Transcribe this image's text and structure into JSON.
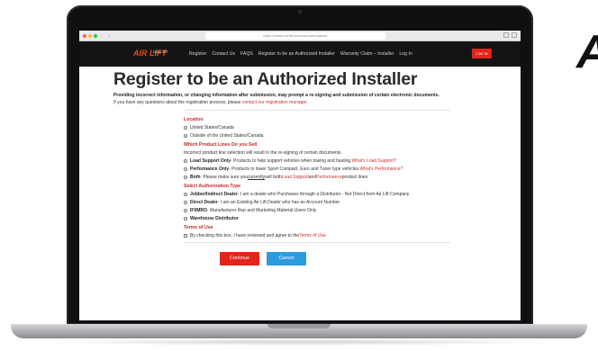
{
  "edge_text": "A",
  "browser": {
    "url": "https://dealer.airliftcompany.com/register"
  },
  "site": {
    "logo": "AIR LIFT",
    "logo_sub": "DEALER",
    "nav": [
      "Register",
      "Contact Us",
      "FAQS",
      "Register to be an Authorized Installer",
      "Warranty Claim – Installer",
      "Log In"
    ],
    "login_button": "LOG IN"
  },
  "page": {
    "title": "Register to be an Authorized Installer",
    "warning": "Providing incorrect information, or changing information after submission, may prompt a re-signing and submission of certain electronic documents.",
    "intro_text": "If you have any questions about the registration process, please ",
    "intro_link": "contact our registration manager."
  },
  "location": {
    "heading": "Location",
    "options": [
      "United States/Canada",
      "Outside of the United States/Canada"
    ]
  },
  "product_lines": {
    "heading": "Which Product Lines Do you Sell",
    "note": "Incorrect product line selection will result in the re-signing of certain documents.",
    "load_support": {
      "name": "Load Support Only",
      "desc": " - Products to help support vehicles when towing and hauling. ",
      "link": "What's Load Support?"
    },
    "performance": {
      "name": "Performance Only",
      "desc": " - Products to lower Sport Compact, Euro and Tuner type vehicles. ",
      "link": "What's Performance?"
    },
    "both": {
      "name": "Both",
      "desc1": " - Please make sure you ",
      "underlined": "currently",
      "desc2": " sell both ",
      "link1": "Load Support",
      "and": " and ",
      "link2": "Performance",
      "desc3": " product lines."
    }
  },
  "authorization": {
    "heading": "Select Authorization Type",
    "jobber": {
      "name": "Jobber/Indirect Dealer",
      "desc": " - I am a dealer who Purchases through a Distributor - Not Direct from Air Lift Company"
    },
    "direct": {
      "name": "Direct Dealer",
      "desc": " - I am an Existing Air Lift Dealer who has an Account Number"
    },
    "ifmro": {
      "name": "IFI/MRO",
      "desc": " - Manufacturer Rep and Marketing Material Users Only"
    },
    "warehouse": {
      "name": "Warehouse Distributor"
    }
  },
  "terms": {
    "heading": "Terms of Use",
    "text": "By checking this box, I have reviewed and agree to the ",
    "link": "Terms of Use."
  },
  "buttons": {
    "continue": "Continue",
    "cancel": "Cancel"
  }
}
